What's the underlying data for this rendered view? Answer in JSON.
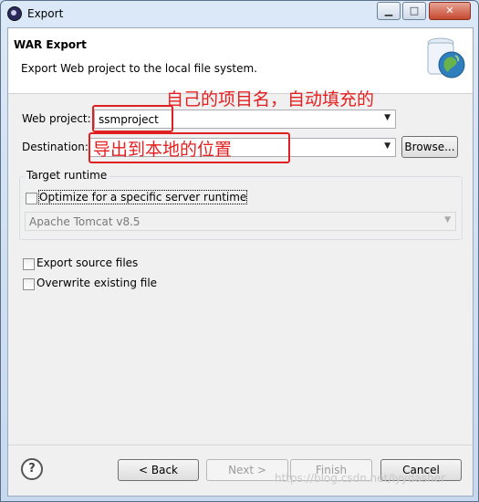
{
  "window": {
    "title": "Export"
  },
  "banner": {
    "title": "WAR Export",
    "description": "Export Web project to the local file system."
  },
  "form": {
    "web_project_label": "Web project:",
    "web_project_value": "ssmproject",
    "destination_label": "Destination:",
    "destination_value": "",
    "browse_label": "Browse..."
  },
  "annotations": {
    "project_note": "自己的项目名，自动填充的",
    "destination_note": "导出到本地的位置",
    "color": "#e02020"
  },
  "target_runtime": {
    "group_label": "Target runtime",
    "optimize_label": "Optimize for a specific server runtime",
    "optimize_checked": false,
    "runtime_value": "Apache Tomcat v8.5"
  },
  "options": {
    "export_source_label": "Export source files",
    "export_source_checked": false,
    "overwrite_label": "Overwrite existing file",
    "overwrite_checked": false
  },
  "buttons": {
    "back": "< Back",
    "next": "Next >",
    "finish": "Finish",
    "cancel": "Cancel"
  },
  "watermark": "https://blog.csdn.net/lyydasher"
}
